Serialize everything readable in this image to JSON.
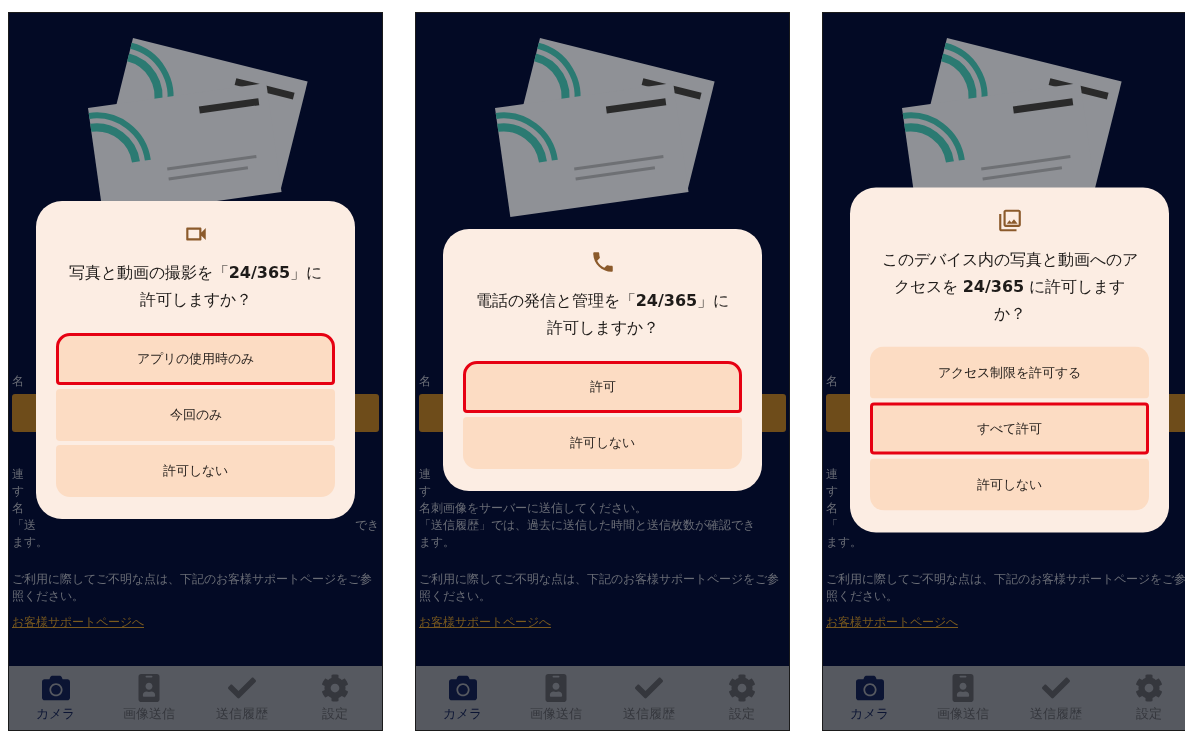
{
  "panels": [
    {
      "dialog": {
        "title": "写真と動画の撮影を「**24/365**」に許可しますか？",
        "options": [
          {
            "label": "アプリの使用時のみ",
            "highlighted": true
          },
          {
            "label": "今回のみ",
            "highlighted": false
          },
          {
            "label": "許可しない",
            "highlighted": false
          }
        ]
      },
      "form_label": "名",
      "info_lines": [
        {
          "left": "連"
        },
        {
          "left": "す"
        },
        {
          "left": "名"
        },
        {
          "left": "「送",
          "right": "でき"
        },
        {
          "left": "ます。"
        }
      ],
      "help_text": "ご利用に際してご不明な点は、下記のお客様サポートページをご参照ください。",
      "support_link": "お客様サポートページへ",
      "nav": [
        {
          "label": "カメラ",
          "selected": true
        },
        {
          "label": "画像送信",
          "selected": false
        },
        {
          "label": "送信履歴",
          "selected": false
        },
        {
          "label": "設定",
          "selected": false
        }
      ]
    },
    {
      "dialog": {
        "title": "電話の発信と管理を「**24/365**」に許可しますか？",
        "options": [
          {
            "label": "許可",
            "highlighted": true
          },
          {
            "label": "許可しない",
            "highlighted": false
          }
        ]
      },
      "form_label": "名",
      "info_lines": [
        {
          "left": "連"
        },
        {
          "left": "す"
        },
        {
          "left": "名刺画像をサーバーに送信してください。"
        },
        {
          "left": "「送信履歴」では、過去に送信した時間と送信枚数が確認でき"
        },
        {
          "left": "ます。"
        }
      ],
      "help_text": "ご利用に際してご不明な点は、下記のお客様サポートページをご参照ください。",
      "support_link": "お客様サポートページへ",
      "nav": [
        {
          "label": "カメラ",
          "selected": true
        },
        {
          "label": "画像送信",
          "selected": false
        },
        {
          "label": "送信履歴",
          "selected": false
        },
        {
          "label": "設定",
          "selected": false
        }
      ]
    },
    {
      "dialog": {
        "title": "このデバイス内の写真と動画へのアクセスを **24/365** に許可しますか？",
        "options": [
          {
            "label": "アクセス制限を許可する",
            "highlighted": false
          },
          {
            "label": "すべて許可",
            "highlighted": true
          },
          {
            "label": "許可しない",
            "highlighted": false
          }
        ]
      },
      "form_label": "名",
      "info_lines": [
        {
          "left": "連"
        },
        {
          "left": "す"
        },
        {
          "left": "名"
        },
        {
          "left": "「"
        },
        {
          "left": "ます。"
        }
      ],
      "help_text": "ご利用に際してご不明な点は、下記のお客様サポートページをご参照ください。",
      "support_link": "お客様サポートページへ",
      "nav": [
        {
          "label": "カメラ",
          "selected": true
        },
        {
          "label": "画像送信",
          "selected": false
        },
        {
          "label": "送信履歴",
          "selected": false
        },
        {
          "label": "設定",
          "selected": false
        }
      ]
    }
  ]
}
